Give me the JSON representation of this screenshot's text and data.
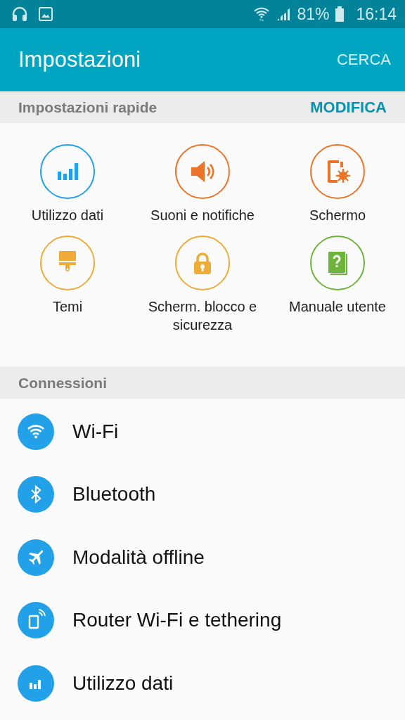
{
  "status_bar": {
    "battery_percent": "81%",
    "time": "16:14"
  },
  "app_bar": {
    "title": "Impostazioni",
    "action": "CERCA"
  },
  "quick_settings": {
    "header": "Impostazioni rapide",
    "edit": "MODIFICA",
    "items": [
      {
        "label": "Utilizzo dati",
        "color": "#22a0e8"
      },
      {
        "label": "Suoni e notifiche",
        "color": "#ea7428"
      },
      {
        "label": "Schermo",
        "color": "#ea7428"
      },
      {
        "label": "Temi",
        "color": "#eeab38"
      },
      {
        "label": "Scherm. blocco e sicurezza",
        "color": "#eeab38"
      },
      {
        "label": "Manuale utente",
        "color": "#6db43a"
      }
    ]
  },
  "connections": {
    "header": "Connessioni",
    "items": [
      {
        "label": "Wi-Fi"
      },
      {
        "label": "Bluetooth"
      },
      {
        "label": "Modalità offline"
      },
      {
        "label": "Router Wi-Fi e tethering"
      },
      {
        "label": "Utilizzo dati"
      }
    ]
  }
}
